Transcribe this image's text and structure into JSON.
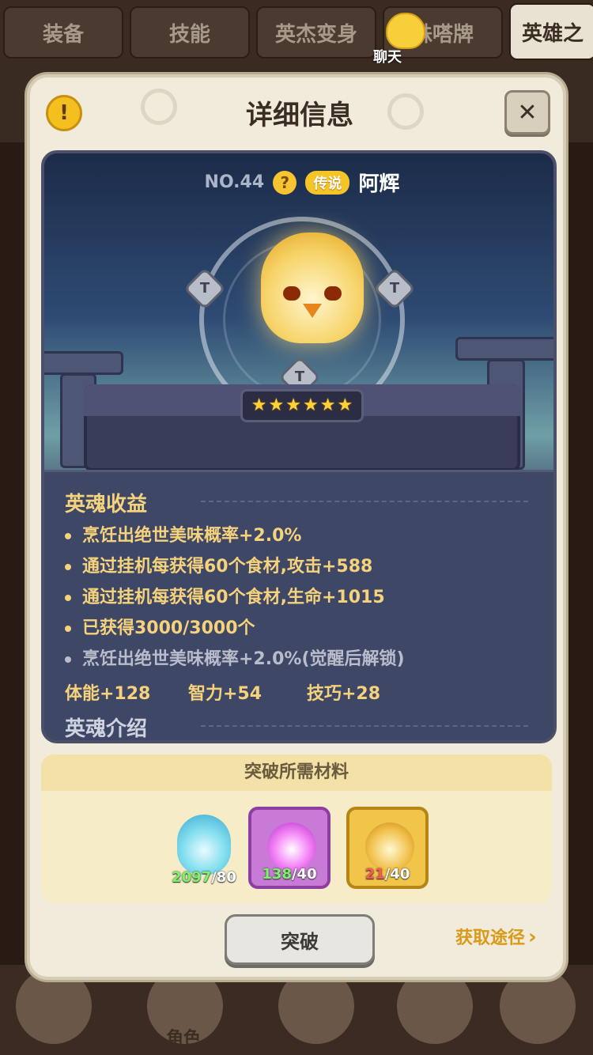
{
  "background": {
    "tabs": [
      "装备",
      "技能",
      "英杰变身",
      "铢嗒牌",
      "英雄之"
    ],
    "chat_label": "聊天",
    "bottom_nav_label": "角色"
  },
  "dialog": {
    "title": "详细信息",
    "info_icon": "!",
    "close_icon": "✕"
  },
  "hero": {
    "number": "NO.44",
    "question_icon": "?",
    "rarity": "传说",
    "name": "阿辉",
    "stars": 6,
    "nodes": [
      "T",
      "T",
      "T"
    ]
  },
  "benefits": {
    "title": "英魂收益",
    "items": [
      "烹饪出绝世美味概率+2.0%",
      "通过挂机每获得60个食材,攻击+588",
      "通过挂机每获得60个食材,生命+1015",
      "已获得3000/3000个"
    ],
    "locked_item": "烹饪出绝世美味概率+2.0%(觉醒后解锁)",
    "stats": [
      "体能+128",
      "智力+54",
      "技巧+28"
    ],
    "intro_title": "英魂介绍"
  },
  "materials": {
    "title": "突破所需材料",
    "items": [
      {
        "have": "2097",
        "need": "/80",
        "icon": "blue-flame-icon"
      },
      {
        "have": "138",
        "need": "/40",
        "icon": "purple-essence-icon"
      },
      {
        "have": "21",
        "need": "/40",
        "icon": "gold-essence-icon"
      }
    ]
  },
  "actions": {
    "breakthrough": "突破",
    "obtain": "获取途径",
    "obtain_chevron": "›"
  },
  "arrows": {
    "left": "‹",
    "right": "›"
  },
  "colors": {
    "accent_gold": "#f5d27c",
    "rarity": "#f5c427",
    "ok": "#7ef26a",
    "bad": "#ff5a4a"
  }
}
